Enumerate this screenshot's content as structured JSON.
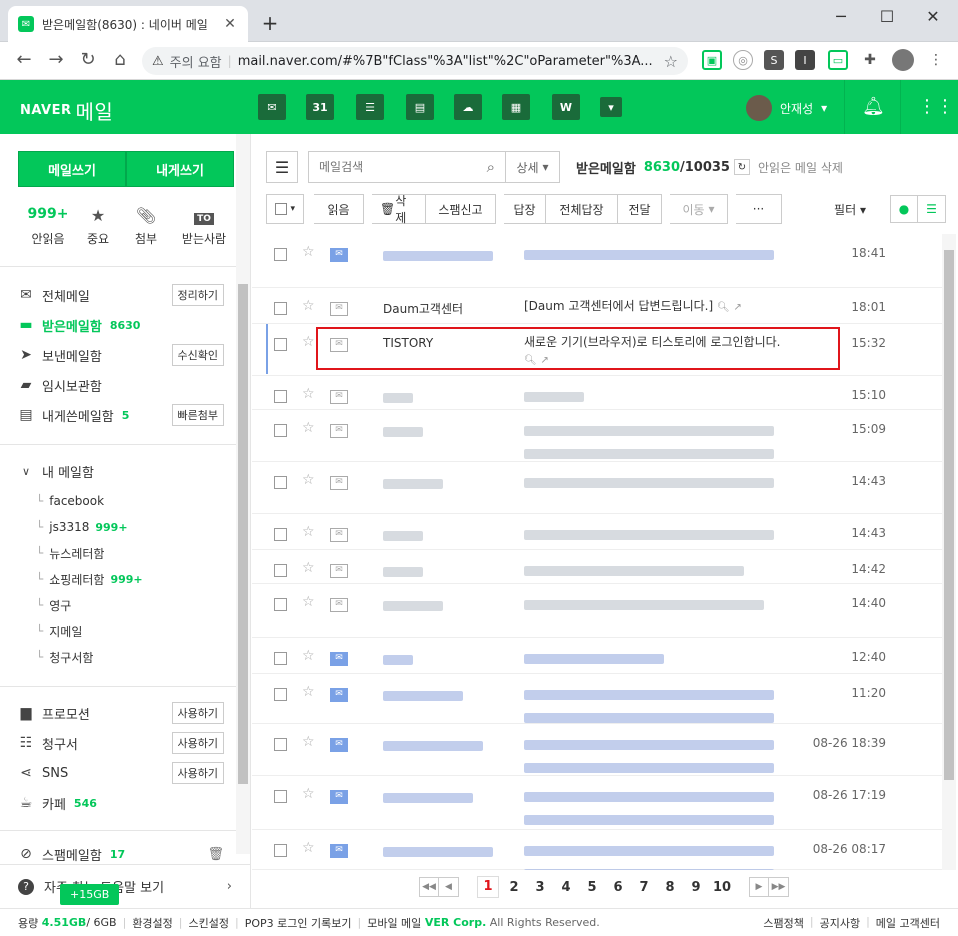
{
  "browser": {
    "tab_title": "받은메일함(8630) : 네이버 메일",
    "security_label": "주의 요함",
    "url": "mail.naver.com/#%7B\"fClass\"%3A\"list\"%2C\"oParameter\"%3A..."
  },
  "header": {
    "logo": "NAVER",
    "logo_product": "메일",
    "service_31": "31",
    "service_w": "W",
    "user_name": "안재성"
  },
  "sidebar": {
    "write_mail": "메일쓰기",
    "write_self": "내게쓰기",
    "quick": [
      {
        "count": "999+",
        "label": "안읽음"
      },
      {
        "count": "",
        "label": "중요"
      },
      {
        "count": "",
        "label": "첨부"
      },
      {
        "count": "",
        "label": "받는사람",
        "icon_text": "TO"
      }
    ],
    "folders": [
      {
        "label": "전체메일",
        "count": "",
        "action": "정리하기"
      },
      {
        "label": "받은메일함",
        "count": "8630",
        "action": ""
      },
      {
        "label": "보낸메일함",
        "count": "",
        "action": "수신확인"
      },
      {
        "label": "임시보관함",
        "count": "",
        "action": ""
      },
      {
        "label": "내게쓴메일함",
        "count": "5",
        "action": "빠른첨부"
      }
    ],
    "my_mailbox_title": "내 메일함",
    "my_mailboxes": [
      {
        "label": "facebook",
        "count": ""
      },
      {
        "label": "js3318",
        "count": "999+"
      },
      {
        "label": "뉴스레터함",
        "count": ""
      },
      {
        "label": "쇼핑레터함",
        "count": "999+"
      },
      {
        "label": "영구",
        "count": ""
      },
      {
        "label": "지메일",
        "count": ""
      },
      {
        "label": "청구서함",
        "count": ""
      }
    ],
    "extras": [
      {
        "label": "프로모션",
        "count": "",
        "action": "사용하기"
      },
      {
        "label": "청구서",
        "count": "",
        "action": "사용하기"
      },
      {
        "label": "SNS",
        "count": "",
        "action": "사용하기"
      },
      {
        "label": "카페",
        "count": "546",
        "action": ""
      }
    ],
    "spam": {
      "label": "스팸메일함",
      "count": "17"
    },
    "help": "자주 찾는 도움말 보기",
    "storage_badge": "+15GB"
  },
  "toolbar": {
    "search_placeholder": "메일검색",
    "detail": "상세",
    "box_name": "받은메일함",
    "unread": "8630",
    "total": "/10035",
    "delete_unread": "안읽은 메일 삭제",
    "read": "읽음",
    "delete": "삭제",
    "spam": "스팸신고",
    "reply": "답장",
    "reply_all": "전체답장",
    "forward": "전달",
    "move": "이동",
    "more": "···",
    "filter": "필터"
  },
  "mails": [
    {
      "sender": "",
      "subject": "",
      "time": "18:41",
      "unread": true
    },
    {
      "sender": "Daum고객센터",
      "subject": "[Daum 고객센터에서 답변드립니다.]",
      "time": "18:01",
      "unread": false
    },
    {
      "sender": "TISTORY",
      "subject": "새로운 기기(브라우저)로 티스토리에 로그인합니다.",
      "time": "15:32",
      "unread": false
    },
    {
      "sender": "",
      "subject": "",
      "time": "15:10",
      "unread": false
    },
    {
      "sender": "",
      "subject": "",
      "time": "15:09",
      "unread": false
    },
    {
      "sender": "",
      "subject": "",
      "time": "14:43",
      "unread": false
    },
    {
      "sender": "",
      "subject": "",
      "time": "14:43",
      "unread": false
    },
    {
      "sender": "",
      "subject": "",
      "time": "14:42",
      "unread": false
    },
    {
      "sender": "",
      "subject": "",
      "time": "14:40",
      "unread": false
    },
    {
      "sender": "",
      "subject": "",
      "time": "12:40",
      "unread": true
    },
    {
      "sender": "",
      "subject": "",
      "time": "11:20",
      "unread": true
    },
    {
      "sender": "",
      "subject": "",
      "time": "08-26 18:39",
      "unread": true
    },
    {
      "sender": "",
      "subject": "",
      "time": "08-26 17:19",
      "unread": true
    },
    {
      "sender": "",
      "subject": "",
      "time": "08-26 08:17",
      "unread": true
    }
  ],
  "pager": {
    "pages": [
      "1",
      "2",
      "3",
      "4",
      "5",
      "6",
      "7",
      "8",
      "9",
      "10"
    ],
    "current": "1"
  },
  "footer": {
    "usage_label": "용량",
    "usage_used": "4.51GB",
    "usage_total": "/ 6GB",
    "links": [
      "환경설정",
      "스킨설정",
      "POP3 로그인 기록보기",
      "모바일 메일"
    ],
    "corp": "VER Corp.",
    "rights": "All Rights Reserved.",
    "right_links": [
      "스팸정책",
      "공지사항",
      "메일 고객센터"
    ]
  },
  "colors": {
    "brand": "#03c75a",
    "highlight": "#e0151b",
    "unread_icon": "#7aa1e6"
  }
}
